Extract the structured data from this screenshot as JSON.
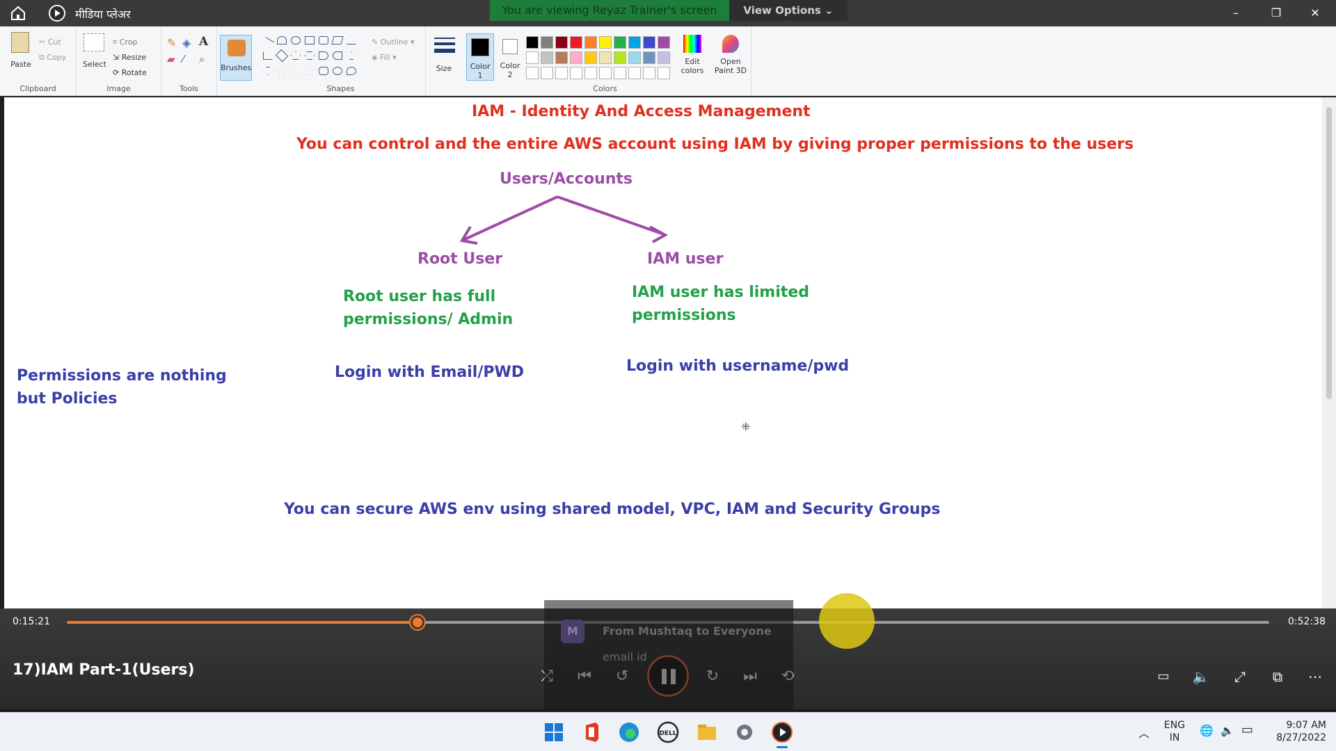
{
  "player": {
    "app_title": "मीडिया प्लेअर",
    "share_banner": "You are viewing Reyaz Trainer's screen",
    "view_options": "View Options",
    "window_controls": {
      "minimize": "–",
      "restore": "❐",
      "close": "✕"
    }
  },
  "ribbon": {
    "clipboard": {
      "paste": "Paste",
      "cut": "Cut",
      "copy": "Copy",
      "label": "Clipboard"
    },
    "image": {
      "select": "Select",
      "crop": "Crop",
      "resize": "Resize",
      "rotate": "Rotate",
      "label": "Image"
    },
    "tools": {
      "label": "Tools"
    },
    "brushes": "Brushes",
    "shapes": {
      "outline": "Outline",
      "fill": "Fill",
      "label": "Shapes"
    },
    "size": "Size",
    "color1": "Color 1",
    "color2": "Color 2",
    "colors_label": "Colors",
    "edit_colors": "Edit colors",
    "open_paint3d": "Open Paint 3D",
    "palette_row1": [
      "#000000",
      "#7f7f7f",
      "#880015",
      "#ed1c24",
      "#ff7f27",
      "#fff200",
      "#22b14c",
      "#00a2e8",
      "#3f48cc",
      "#a349a4"
    ],
    "palette_row2": [
      "#ffffff",
      "#c3c3c3",
      "#b97a57",
      "#ffaec9",
      "#ffc90e",
      "#efe4b0",
      "#b5e61d",
      "#99d9ea",
      "#7092be",
      "#c8bfe7"
    ]
  },
  "canvas": {
    "title": "IAM - Identity And Access Management",
    "subtitle": "You can control and the entire AWS account using IAM by giving proper permissions to the users",
    "users_accounts": "Users/Accounts",
    "root_user": "Root User",
    "iam_user": "IAM user",
    "root_desc_1": "Root user has full",
    "root_desc_2": "permissions/ Admin",
    "iam_desc_1": "IAM user has limited",
    "iam_desc_2": "permissions",
    "root_login": "Login with Email/PWD",
    "iam_login": "Login with username/pwd",
    "policies_1": "Permissions are nothing",
    "policies_2": "but Policies",
    "secure": "You can secure AWS env using shared model, VPC, IAM and Security Groups"
  },
  "controls": {
    "elapsed": "0:15:21",
    "duration": "0:52:38",
    "progress": 0.2916,
    "media_title": "17)IAM Part-1(Users)",
    "chat_from": "From Mushtaq to Everyone",
    "chat_text": "email id"
  },
  "taskbar": {
    "lang_1": "ENG",
    "lang_2": "IN",
    "time": "9:07 AM",
    "date": "8/27/2022"
  }
}
